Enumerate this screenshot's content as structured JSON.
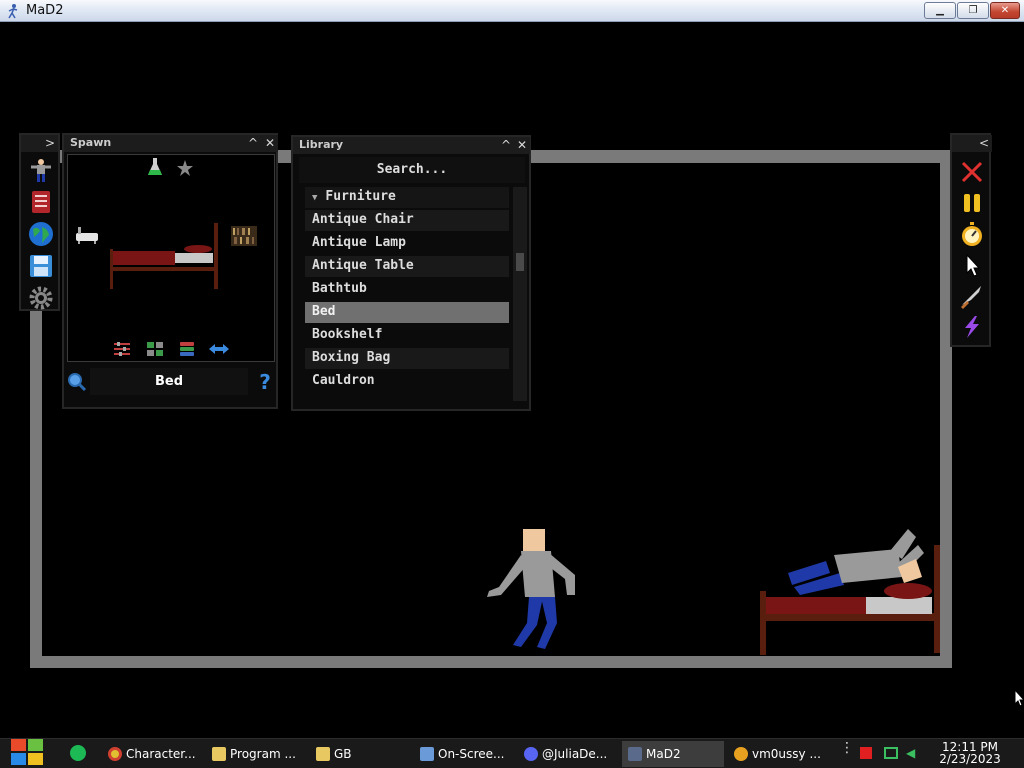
{
  "window": {
    "title": "MaD2",
    "min": "▁",
    "restore": "❐",
    "close": "✕"
  },
  "spawn_panel": {
    "title": "Spawn",
    "collapse": "^",
    "close": "✕",
    "search_value": "Bed",
    "help": "?"
  },
  "library_panel": {
    "title": "Library",
    "collapse": "^",
    "close": "✕",
    "search_placeholder": "Search...",
    "category": "Furniture",
    "items": [
      {
        "label": "Antique Chair"
      },
      {
        "label": "Antique Lamp"
      },
      {
        "label": "Antique Table"
      },
      {
        "label": "Bathtub"
      },
      {
        "label": "Bed",
        "selected": true
      },
      {
        "label": "Bookshelf"
      },
      {
        "label": "Boxing Bag"
      },
      {
        "label": "Cauldron"
      }
    ]
  },
  "left_toolbar": {
    "expand": ">",
    "tools": [
      "ragdoll-icon",
      "book-icon",
      "globe-icon",
      "save-icon",
      "settings-gear-icon"
    ]
  },
  "right_toolbar": {
    "collapse": "<",
    "tools": [
      "clear-x-icon",
      "pause-icon",
      "slowmo-stopwatch-icon",
      "pointer-icon",
      "knife-icon",
      "lightning-icon"
    ]
  },
  "taskbar": {
    "items": [
      {
        "label": "Character...",
        "icon": "chrome-icon"
      },
      {
        "label": "Program ...",
        "icon": "folder-icon"
      },
      {
        "label": "GB",
        "icon": "folder-icon"
      },
      {
        "label": "On-Scree...",
        "icon": "keyboard-icon"
      },
      {
        "label": "@JuliaDe...",
        "icon": "discord-icon"
      },
      {
        "label": "MaD2",
        "icon": "mad2-icon",
        "active": true
      },
      {
        "label": "vm0ussy ...",
        "icon": "x-icon"
      }
    ],
    "time": "12:11 PM",
    "date": "2/23/2023"
  },
  "colors": {
    "arena_wall": "#7a7a7a",
    "bed_frame": "#5a1e0e",
    "blanket": "#7a1515",
    "shirt": "#9a9a9a",
    "pants": "#1f3aa8",
    "skin": "#f0c8a0"
  }
}
